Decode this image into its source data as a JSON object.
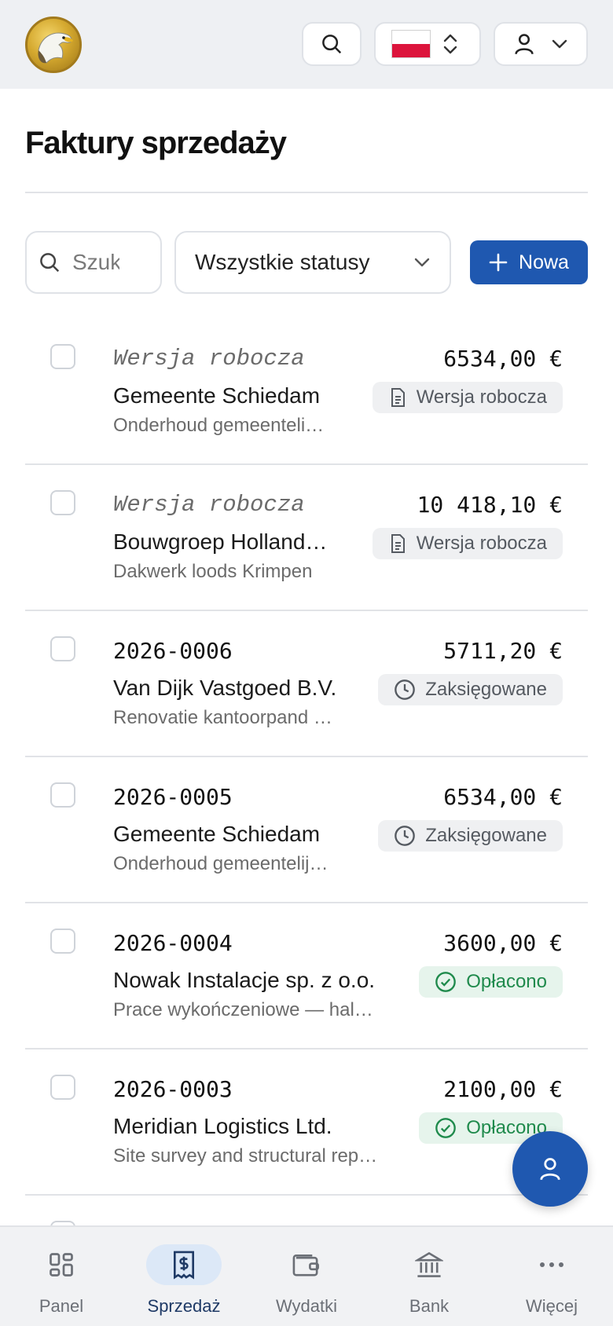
{
  "header": {
    "logo_alt": "eagle-logo",
    "language": {
      "flag": "poland-flag",
      "colors": [
        "#ffffff",
        "#dc143c"
      ]
    }
  },
  "page": {
    "title": "Faktury sprzedaży"
  },
  "filters": {
    "search_placeholder": "Szukaj",
    "status_select": "Wszystkie statusy",
    "new_button": "Nowa"
  },
  "invoices": [
    {
      "number": "Wersja robocza",
      "draft": true,
      "amount": "6534,00 €",
      "client": "Gemeente Schiedam",
      "description": "Onderhoud gemeenteli…",
      "status": "Wersja robocza",
      "status_kind": "draft"
    },
    {
      "number": "Wersja robocza",
      "draft": true,
      "amount": "10 418,10 €",
      "client": "Bouwgroep Holland…",
      "description": "Dakwerk loods Krimpen",
      "status": "Wersja robocza",
      "status_kind": "draft"
    },
    {
      "number": "2026-0006",
      "draft": false,
      "amount": "5711,20 €",
      "client": "Van Dijk Vastgoed B.V.",
      "description": "Renovatie kantoorpand …",
      "status": "Zaksięgowane",
      "status_kind": "posted"
    },
    {
      "number": "2026-0005",
      "draft": false,
      "amount": "6534,00 €",
      "client": "Gemeente Schiedam",
      "description": "Onderhoud gemeentelij…",
      "status": "Zaksięgowane",
      "status_kind": "posted"
    },
    {
      "number": "2026-0004",
      "draft": false,
      "amount": "3600,00 €",
      "client": "Nowak Instalacje sp. z o.o.",
      "description": "Prace wykończeniowe — hal…",
      "status": "Opłacono",
      "status_kind": "paid"
    },
    {
      "number": "2026-0003",
      "draft": false,
      "amount": "2100,00 €",
      "client": "Meridian Logistics Ltd.",
      "description": "Site survey and structural rep…",
      "status": "Opłacono",
      "status_kind": "paid"
    }
  ],
  "bottom_nav": [
    {
      "label": "Panel",
      "icon": "dashboard-icon",
      "active": false
    },
    {
      "label": "Sprzedaż",
      "icon": "receipt-dollar-icon",
      "active": true
    },
    {
      "label": "Wydatki",
      "icon": "wallet-icon",
      "active": false
    },
    {
      "label": "Bank",
      "icon": "bank-icon",
      "active": false
    },
    {
      "label": "Więcej",
      "icon": "more-icon",
      "active": false
    }
  ],
  "colors": {
    "primary": "#1f58b0",
    "paid_green": "#1f8a4c",
    "badge_gray": "#eff0f2"
  }
}
